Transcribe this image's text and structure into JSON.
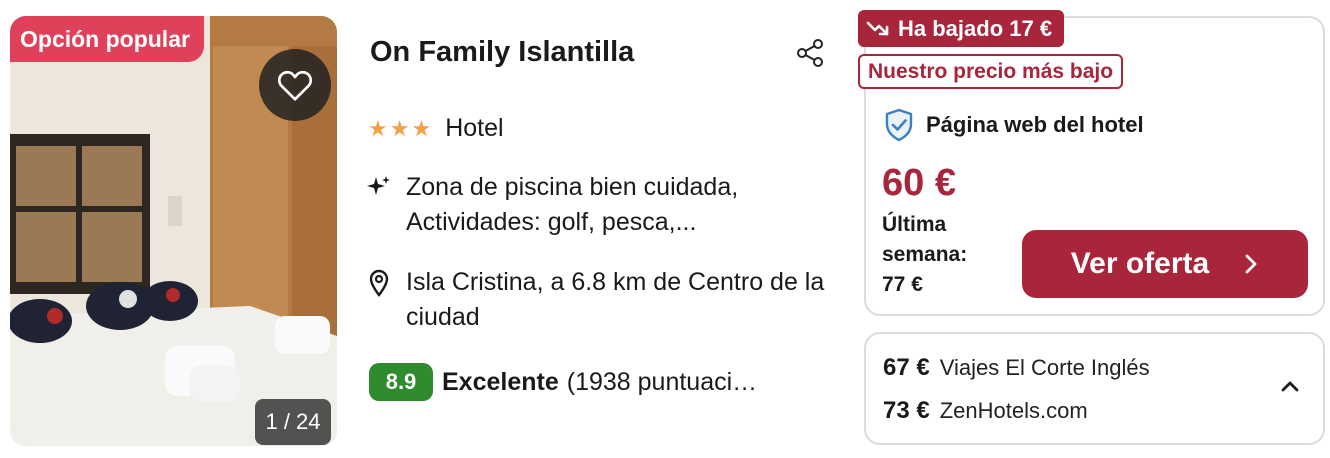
{
  "photo": {
    "badge": "Opción popular",
    "counter": "1 / 24",
    "favorite_icon": "heart-icon"
  },
  "hotel": {
    "name": "On Family Islantilla",
    "stars": 3,
    "type": "Hotel",
    "features": "Zona de piscina bien cuidada, Actividades: golf, pesca,...",
    "location": "Isla Cristina, a 6.8 km de Centro de la ciudad",
    "rating_score": "8.9",
    "rating_label": "Excelente",
    "rating_count": "(1938 puntuaci…",
    "share_icon": "share-icon"
  },
  "deal": {
    "drop_badge": "Ha bajado 17 €",
    "lowest_badge": "Nuestro precio más bajo",
    "provider": "Página web del hotel",
    "price": "60 €",
    "last_week_label": "Última semana:",
    "last_week_price": "77 €",
    "cta_label": "Ver oferta"
  },
  "other_offers": [
    {
      "price": "67 €",
      "provider": "Viajes El Corte Inglés"
    },
    {
      "price": "73 €",
      "provider": "ZenHotels.com"
    }
  ],
  "colors": {
    "accent": "#a8253b",
    "popular_badge": "#e0415a",
    "rating": "#2e8b2e",
    "stars": "#f0a24a"
  }
}
